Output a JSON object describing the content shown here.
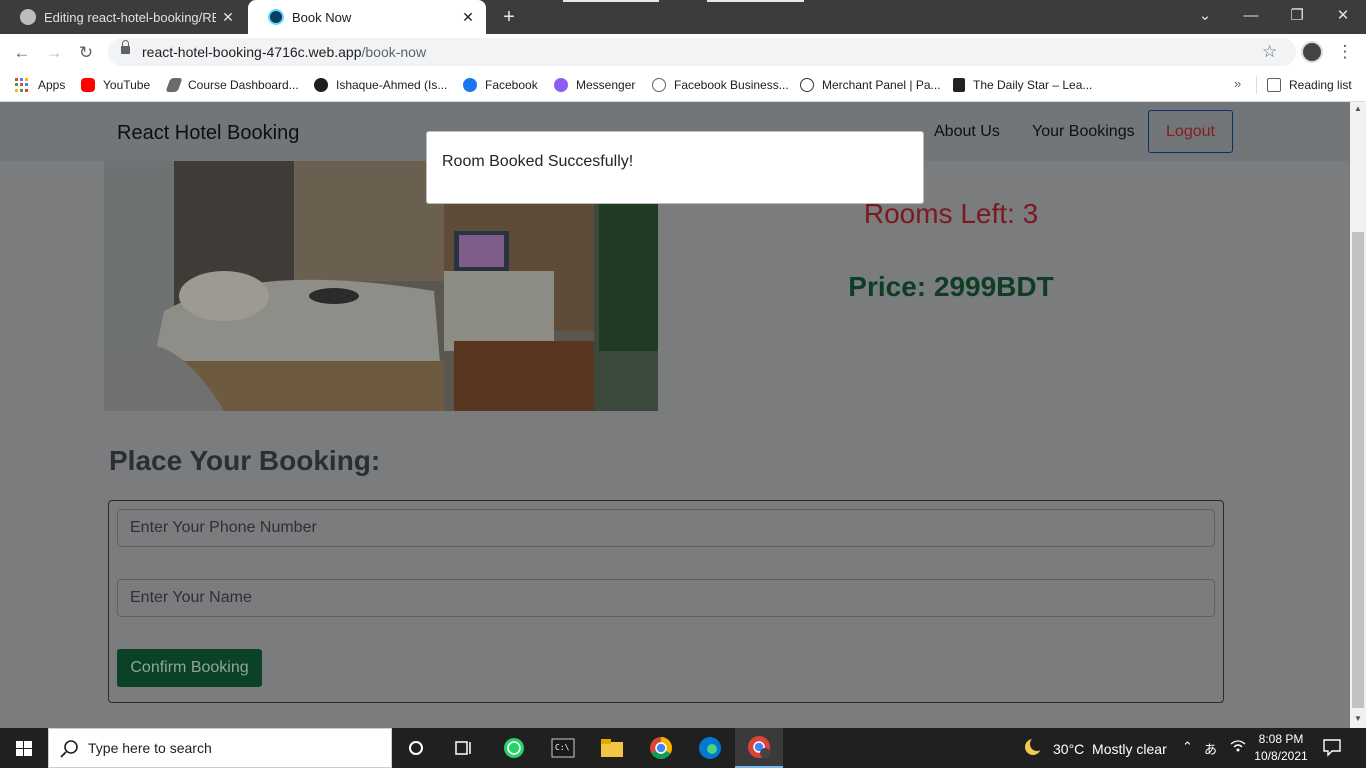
{
  "browser": {
    "tabs": [
      {
        "title": "Editing react-hotel-booking/README.md",
        "active": false
      },
      {
        "title": "Book Now",
        "active": true
      }
    ],
    "url_domain": "react-hotel-booking-4716c.web.app",
    "url_path": "/book-now",
    "bookmarks": [
      "Apps",
      "YouTube",
      "Course Dashboard...",
      "Ishaque-Ahmed (Is...",
      "Facebook",
      "Messenger",
      "Facebook Business...",
      "Merchant Panel | Pa...",
      "The Daily Star – Lea..."
    ],
    "bookmark_more": "»",
    "reading_list": "Reading list"
  },
  "site": {
    "brand": "React Hotel Booking",
    "nav": [
      "About Us",
      "Your Bookings"
    ],
    "logout": "Logout",
    "rooms_left": "Rooms Left: 3",
    "price": "Price: 2999BDT",
    "place_title": "Place Your Booking:",
    "phone_placeholder": "Enter Your Phone Number",
    "name_placeholder": "Enter Your Name",
    "confirm": "Confirm Booking"
  },
  "modal": {
    "message": "Room Booked Succesfully!"
  },
  "taskbar": {
    "search_placeholder": "Type here to search",
    "weather": "30°C  Mostly clear",
    "time": "8:08 PM",
    "date": "10/8/2021"
  },
  "colors": {
    "rooms_left": "#7a1a1f",
    "price": "#0d3d24",
    "confirm_bg": "#0b4126",
    "logout_border": "#0b3068"
  }
}
